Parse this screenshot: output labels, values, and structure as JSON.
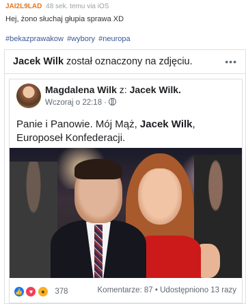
{
  "post": {
    "author": "JAI2L9LAD",
    "time": "48 sek. temu",
    "via": "via",
    "platform": "iOS",
    "text": "Hej, żono słuchaj głupia sprawa XD",
    "tags": [
      "#bekazprawakow",
      "#wybory",
      "#neuropa"
    ]
  },
  "fb": {
    "tag_name": "Jacek Wilk",
    "tag_suffix": " został oznaczony na zdjęciu.",
    "menu": "•••",
    "poster": "Magdalena Wilk",
    "poster_with": " z: ",
    "poster_target": "Jacek Wilk.",
    "time": "Wczoraj o 22:18 ·",
    "body_1": "Panie i Panowie. Mój Mąż, ",
    "body_bold": "Jacek Wilk",
    "body_2": ",",
    "body_3": "Europoseł Konfederacji.",
    "reaction_count": "378",
    "stats": "Komentarze: 87 • Udostępniono 13 razy",
    "reactions": [
      "like-icon",
      "love-icon",
      "wow-icon"
    ]
  }
}
